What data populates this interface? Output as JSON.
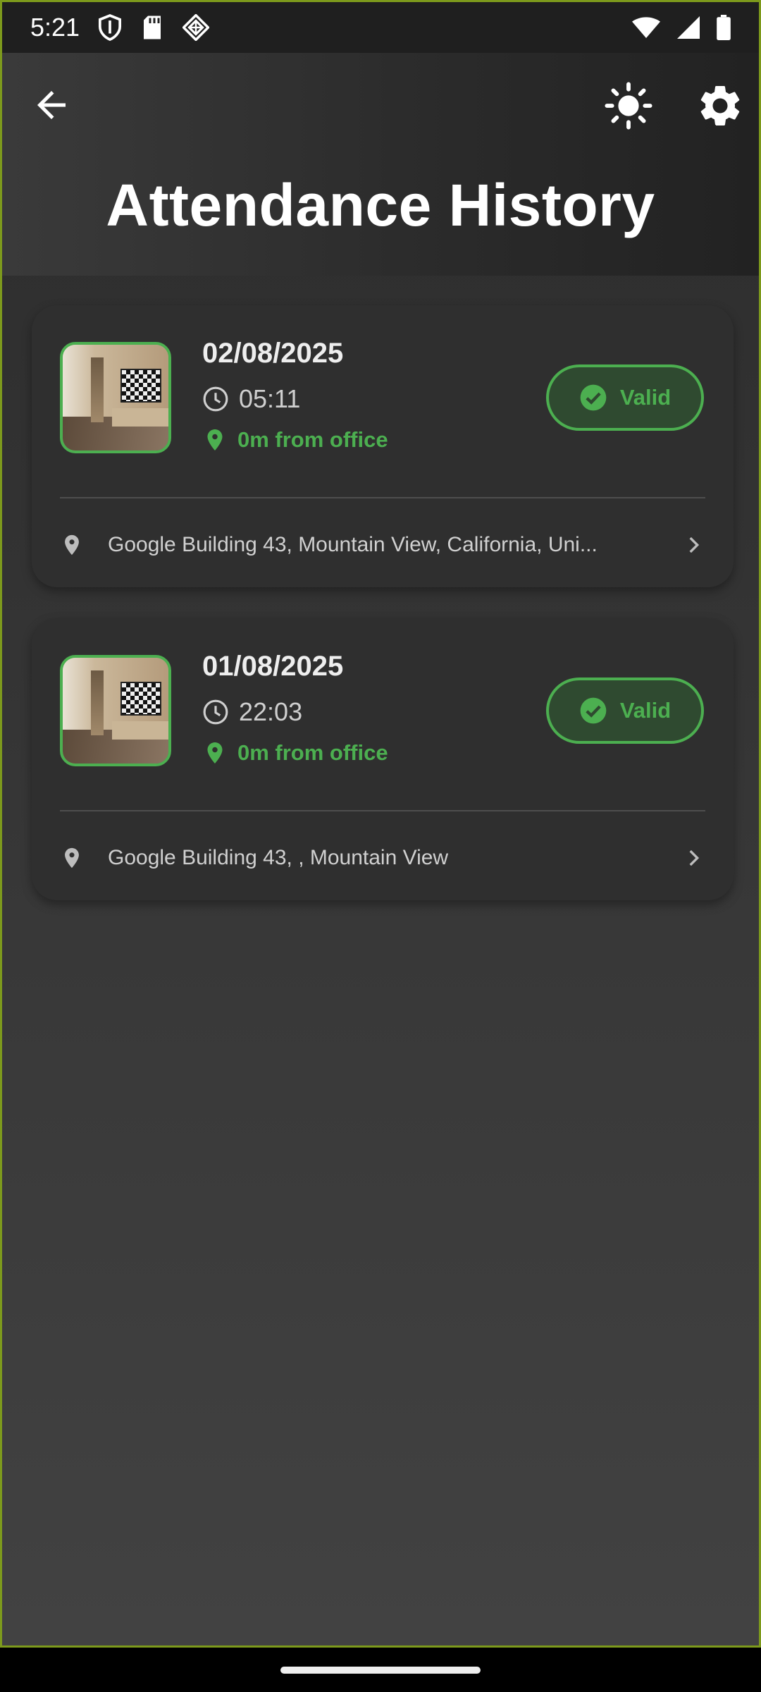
{
  "status_bar": {
    "time": "5:21",
    "left_icons": [
      "shield-icon",
      "sd-card-icon",
      "ar-core-icon"
    ],
    "right_icons": [
      "wifi-icon",
      "cell-signal-icon",
      "battery-icon"
    ]
  },
  "app_bar": {
    "title": "Attendance History",
    "back_icon": "arrow-back-icon",
    "theme_icon": "sun-icon",
    "settings_icon": "gear-icon"
  },
  "records": [
    {
      "date": "02/08/2025",
      "time": "05:11",
      "distance": "0m from office",
      "status": "Valid",
      "address": "Google Building 43, Mountain View, California, Uni..."
    },
    {
      "date": "01/08/2025",
      "time": "22:03",
      "distance": "0m from office",
      "status": "Valid",
      "address": "Google Building 43, , Mountain View"
    }
  ],
  "colors": {
    "accent": "#4caf50",
    "card": "#2f2f2f",
    "frame": "#7d9a1c"
  }
}
